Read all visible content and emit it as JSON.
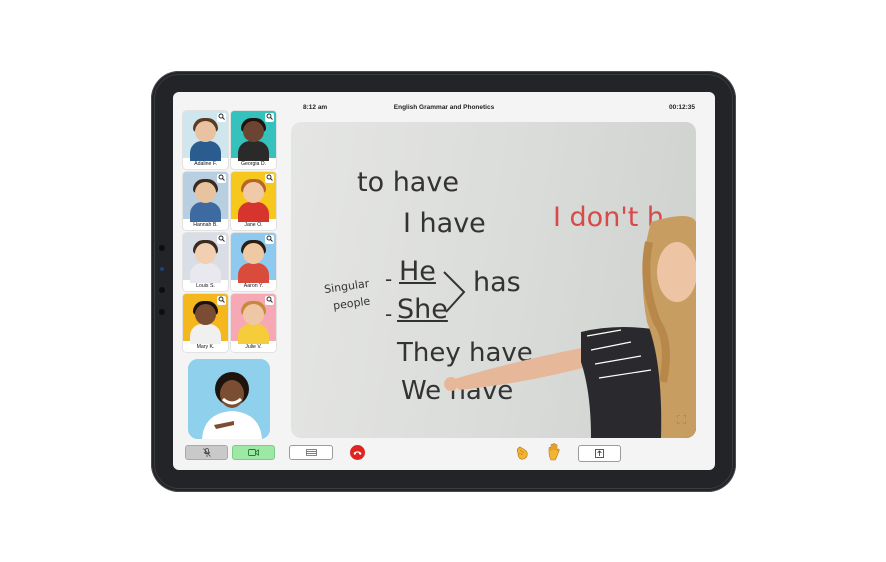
{
  "status_bar": {
    "time": "8:12 am",
    "title": "English Grammar and Phonetics",
    "elapsed": "00:12:35"
  },
  "participants": [
    {
      "name": "Adaline F.",
      "bg": "#cfe6ee",
      "skin": "#e9c2a2",
      "hair": "#5a3a22",
      "shirt": "#2b5c8f"
    },
    {
      "name": "Georgia D.",
      "bg": "#36c2bc",
      "skin": "#6b4531",
      "hair": "#1f140d",
      "shirt": "#2a2a2a"
    },
    {
      "name": "Hannah B.",
      "bg": "#b8cfe2",
      "skin": "#e8c3a0",
      "hair": "#3b2a1c",
      "shirt": "#3d6aa0"
    },
    {
      "name": "Jane O.",
      "bg": "#f6c81e",
      "skin": "#f0c9a8",
      "hair": "#b5652a",
      "shirt": "#d8342e"
    },
    {
      "name": "Louis S.",
      "bg": "#d8dde6",
      "skin": "#f1cfb0",
      "hair": "#3a2b1f",
      "shirt": "#e8e8ee"
    },
    {
      "name": "Aaron Y.",
      "bg": "#8ec9ef",
      "skin": "#efc8a4",
      "hair": "#2b1d12",
      "shirt": "#d94b3a"
    },
    {
      "name": "Mary K.",
      "bg": "#f4b71d",
      "skin": "#7a4c33",
      "hair": "#1a120c",
      "shirt": "#f0f0f0"
    },
    {
      "name": "Julie V.",
      "bg": "#f6a9b5",
      "skin": "#efc7a6",
      "hair": "#c58a3c",
      "shirt": "#f5cc3a"
    }
  ],
  "board": {
    "line1": "to have",
    "line2": "I have",
    "line3_red": "I don't h",
    "line4_he": "He",
    "line4_has": "has",
    "line5_she": "She",
    "side_note_1": "Singular",
    "side_note_2": "people",
    "line6": "They have",
    "line7": "We have"
  },
  "icons": {
    "zoom": "magnifier-icon",
    "mic": "mic-muted-icon",
    "camera": "camera-icon",
    "layout": "layout-list-icon",
    "end_call": "phone-hangup-icon",
    "clap": "clap-icon",
    "raise_hand": "raise-hand-icon",
    "share": "share-icon",
    "expand": "expand-icon"
  },
  "colors": {
    "end_call": "#e02420",
    "camera_on": "#9ee8a6",
    "board_red": "#d64a4a"
  }
}
